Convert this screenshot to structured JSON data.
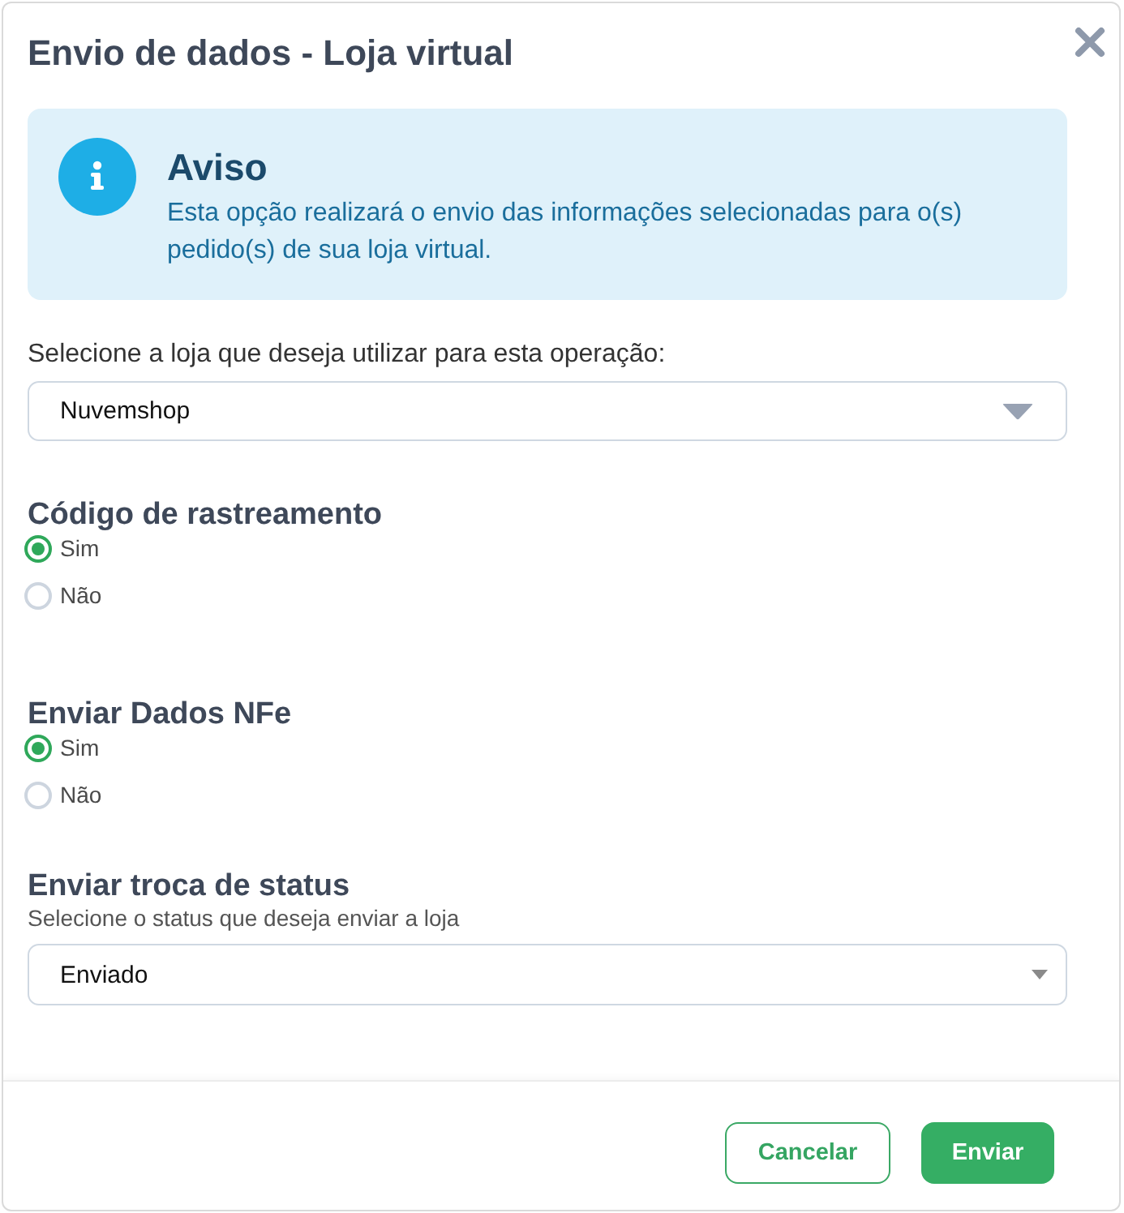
{
  "dialog": {
    "title": "Envio de dados - Loja virtual"
  },
  "notice": {
    "title": "Aviso",
    "text": "Esta opção realizará o envio das informações selecionadas para o(s) pedido(s) de sua loja virtual."
  },
  "store_select": {
    "label": "Selecione a loja que deseja utilizar para esta operação:",
    "value": "Nuvemshop"
  },
  "option_groups": [
    {
      "title": "Código de rastreamento",
      "options": [
        {
          "label": "Sim",
          "selected": true
        },
        {
          "label": "Não",
          "selected": false
        }
      ]
    },
    {
      "title": "Enviar Dados NFe",
      "options": [
        {
          "label": "Sim",
          "selected": true
        },
        {
          "label": "Não",
          "selected": false
        }
      ]
    }
  ],
  "status_select": {
    "title": "Enviar troca de status",
    "hint": "Selecione o status que deseja enviar a loja",
    "value": "Enviado"
  },
  "buttons": [
    {
      "label": "Cancelar",
      "kind": "secondary"
    },
    {
      "label": "Enviar",
      "kind": "primary"
    }
  ]
}
